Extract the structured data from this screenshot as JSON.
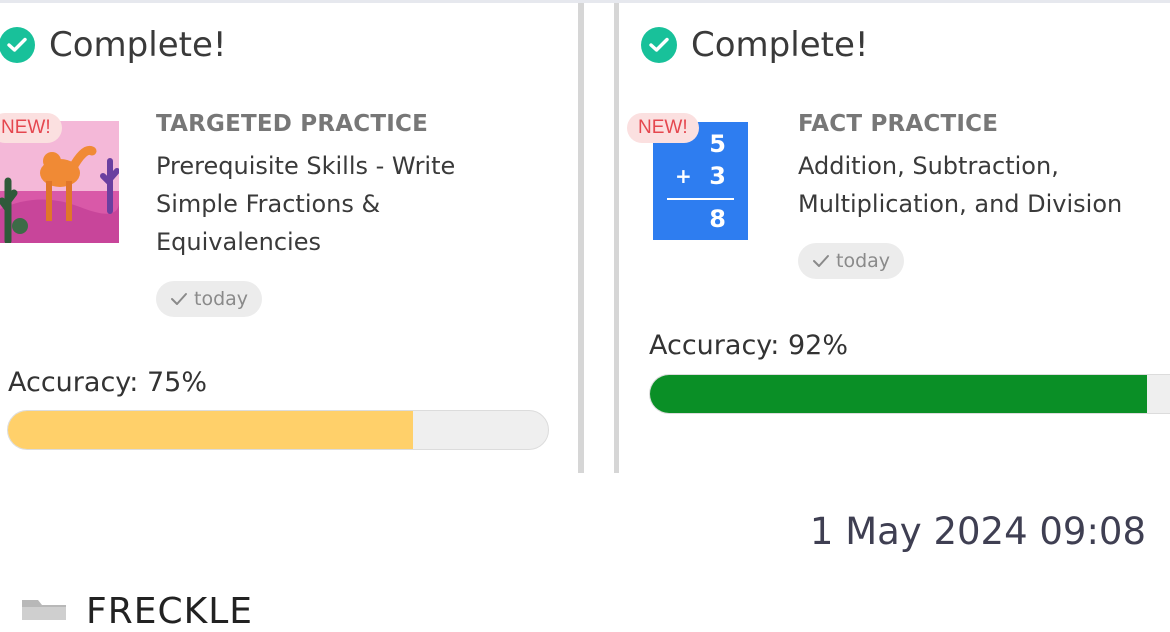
{
  "cards": [
    {
      "status": "Complete!",
      "badge": "NEW!",
      "category": "TARGETED PRACTICE",
      "title_lines": [
        "Prerequisite Skills - Write",
        "Simple Fractions &",
        "Equivalencies"
      ],
      "date_pill": "today",
      "accuracy_label": "Accuracy: 75%",
      "accuracy_fraction": 0.75,
      "bar_color": "#ffd06a",
      "thumb_icon": "camel-desert-illustration"
    },
    {
      "status": "Complete!",
      "badge": "NEW!",
      "category": "FACT PRACTICE",
      "title_lines": [
        "Addition, Subtraction,",
        "Multiplication, and Division"
      ],
      "date_pill": "today",
      "accuracy_label": "Accuracy: 92%",
      "accuracy_fraction": 0.92,
      "bar_color": "#0a8f26",
      "thumb_icon": "math-flashcard",
      "flashcard": {
        "top": "5",
        "op": "+",
        "bottom": "3",
        "answer": "8"
      }
    }
  ],
  "timestamp": "1 May 2024 09:08",
  "footer": {
    "folder_icon": "folder-icon",
    "app_name": "FRECKLE"
  },
  "colors": {
    "check": "#18c19a",
    "badge_bg": "#fbe0e0",
    "badge_text": "#e5474f",
    "flashcard_bg": "#2e7df0"
  }
}
